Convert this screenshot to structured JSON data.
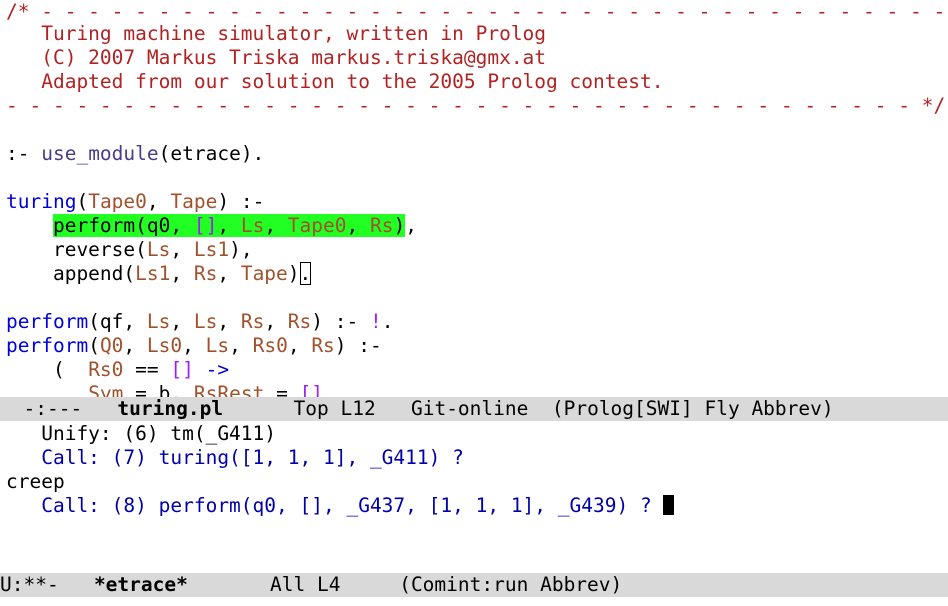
{
  "editor": {
    "comment_top": "/* - - - - - - - - - - - - - - - - - - - - - - - - - - - - - - - - - - - - - - -",
    "comment_l1": "   Turing machine simulator, written in Prolog",
    "comment_l2": "   (C) 2007 Markus Triska markus.triska@gmx.at",
    "comment_l3": "   Adapted from our solution to the 2005 Prolog contest.",
    "comment_bottom": "- - - - - - - - - - - - - - - - - - - - - - - - - - - - - - - - - - - - - - - */"
  },
  "modeline_top": {
    "status": "-:---",
    "buffer": "turing.pl",
    "position": "Top L12",
    "vc": "Git-online",
    "modes": "(Prolog[SWI] Fly Abbrev)"
  },
  "repl": {
    "line1": "   Unify: (6) tm(_G411)",
    "line2": "   Call: (7) turing([1, 1, 1], _G411) ?",
    "line3": "creep",
    "line4": "   Call: (8) perform(q0, [], _G437, [1, 1, 1], _G439) ?"
  },
  "modeline_bottom": {
    "status": "U:**-",
    "buffer": "*etrace*",
    "position": "All L4",
    "modes": "(Comint:run Abbrev)"
  },
  "colors": {
    "comment": "#b22222",
    "keyword": "#0000dd",
    "variable": "#a0522d",
    "list": "#a020f0",
    "highlight": "#22ff22",
    "repl_text": "#0000aa",
    "modeline_bg": "#d9d9d9"
  }
}
